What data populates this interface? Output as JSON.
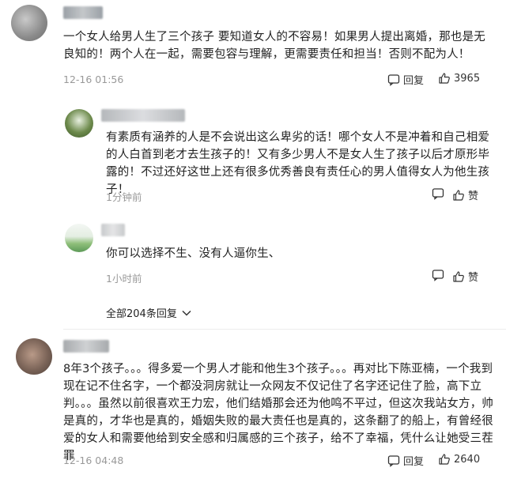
{
  "comments": [
    {
      "text": "一个女人给男人生了三个孩子 要知道女人的不容易！如果男人提出离婚，那也是无良知的！两个人在一起，需要包容与理解，更需要责任和担当！否则不配为人！",
      "time": "12-16 01:56",
      "reply_label": "回复",
      "like_count": "3965"
    },
    {
      "text": "有素质有涵养的人是不会说出这么卑劣的话！哪个女人不是冲着和自己相爱的人白首到老才去生孩子的！又有多少男人不是女人生了孩子以后才原形毕露的！不过还好这世上还有很多优秀善良有责任心的男人值得女人为他生孩子！",
      "time": "1分钟前",
      "like_label": "赞"
    },
    {
      "text": "你可以选择不生、没有人逼你生、",
      "time": "1小时前",
      "like_label": "赞"
    },
    {
      "text": "8年3个孩子。。。得多爱一个男人才能和他生3个孩子。。。再对比下陈亚楠，一个我到现在记不住名字，一个都没洞房就让一众网友不仅记住了名字还记住了脸，高下立判。。。虽然以前很喜欢王力宏，他们结婚那会还为他鸣不平过，但这次我站女方，帅是真的，才华也是真的，婚姻失败的最大责任也是真的，这条翻了的船上，有曾经很爱的女人和需要他给到安全感和归属感的三个孩子，给不了幸福，凭什么让她受三茬罪",
      "time": "12-16 04:48",
      "reply_label": "回复",
      "like_count": "2640"
    }
  ],
  "expand_replies": "全部204条回复",
  "colors": {
    "meta": "#999999",
    "text": "#222222",
    "divider": "#ececec"
  }
}
